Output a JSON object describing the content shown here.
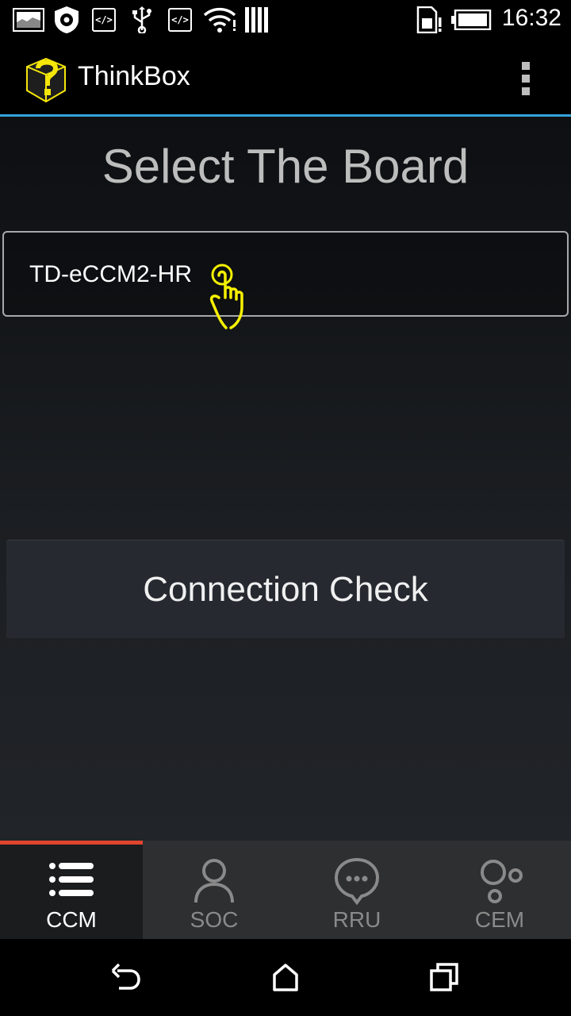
{
  "status_bar": {
    "time": "16:32",
    "icons": [
      "image-icon",
      "settings-shield-icon",
      "code-icon",
      "usb-icon",
      "code-icon",
      "wifi-icon",
      "signal-bars-icon",
      "sim-alert-icon",
      "battery-icon"
    ]
  },
  "action_bar": {
    "title": "ThinkBox",
    "logo_icon": "thinkbox-logo-icon",
    "overflow_icon": "more-vert-icon"
  },
  "main": {
    "title": "Select The Board",
    "board_select": {
      "value": "TD-eCCM2-HR"
    },
    "connection_button": "Connection Check"
  },
  "tabs": [
    {
      "label": "CCM",
      "icon": "list-icon",
      "active": true
    },
    {
      "label": "SOC",
      "icon": "person-icon",
      "active": false
    },
    {
      "label": "RRU",
      "icon": "chat-bubble-icon",
      "active": false
    },
    {
      "label": "CEM",
      "icon": "circles-icon",
      "active": false
    }
  ],
  "nav_bar": [
    "back-icon",
    "home-icon",
    "recents-icon"
  ],
  "colors": {
    "accent_line": "#33a3dc",
    "tab_active_indicator": "#e0452f",
    "logo_yellow": "#f5e60a"
  }
}
